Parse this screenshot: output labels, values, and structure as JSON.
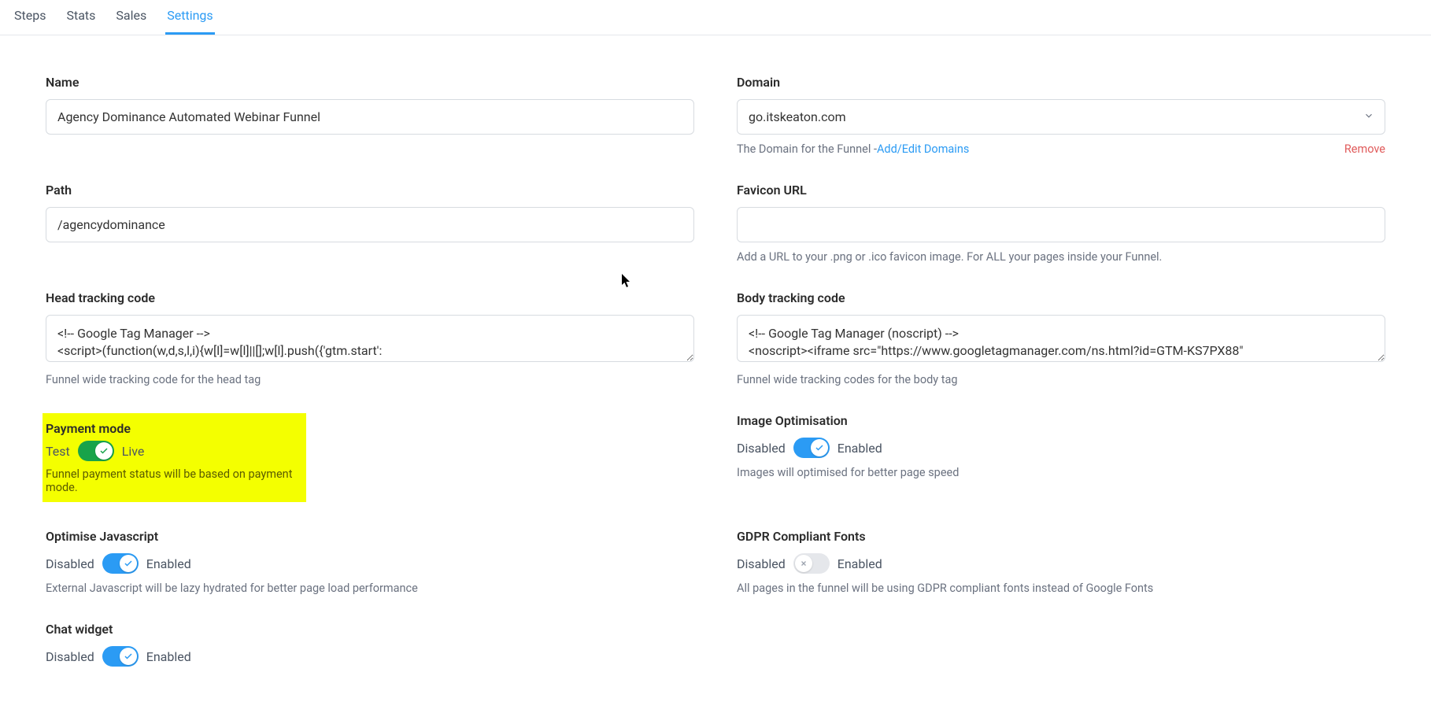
{
  "tabs": {
    "steps": "Steps",
    "stats": "Stats",
    "sales": "Sales",
    "settings": "Settings"
  },
  "left": {
    "name": {
      "label": "Name",
      "value": "Agency Dominance Automated Webinar Funnel"
    },
    "path": {
      "label": "Path",
      "value": "/agencydominance"
    },
    "head_tracking": {
      "label": "Head tracking code",
      "value": "<!-- Google Tag Manager -->\n<script>(function(w,d,s,l,i){w[l]=w[l]||[];w[l].push({'gtm.start':",
      "help": "Funnel wide tracking code for the head tag"
    },
    "payment_mode": {
      "label": "Payment mode",
      "off_label": "Test",
      "on_label": "Live",
      "help": "Funnel payment status will be based on payment mode."
    },
    "optimise_js": {
      "label": "Optimise Javascript",
      "off_label": "Disabled",
      "on_label": "Enabled",
      "help": "External Javascript will be lazy hydrated for better page load performance"
    },
    "chat_widget": {
      "label": "Chat widget",
      "off_label": "Disabled",
      "on_label": "Enabled"
    }
  },
  "right": {
    "domain": {
      "label": "Domain",
      "value": "go.itskeaton.com",
      "help_prefix": "The Domain for the Funnel -",
      "help_link": "Add/Edit Domains",
      "remove": "Remove"
    },
    "favicon": {
      "label": "Favicon URL",
      "value": "",
      "help": "Add a URL to your .png or .ico favicon image. For ALL your pages inside your Funnel."
    },
    "body_tracking": {
      "label": "Body tracking code",
      "value": "<!-- Google Tag Manager (noscript) -->\n<noscript><iframe src=\"https://www.googletagmanager.com/ns.html?id=GTM-KS7PX88\"",
      "help": "Funnel wide tracking codes for the body tag"
    },
    "image_opt": {
      "label": "Image Optimisation",
      "off_label": "Disabled",
      "on_label": "Enabled",
      "help": "Images will optimised for better page speed"
    },
    "gdpr_fonts": {
      "label": "GDPR Compliant Fonts",
      "off_label": "Disabled",
      "on_label": "Enabled",
      "help": "All pages in the funnel will be using GDPR compliant fonts instead of Google Fonts"
    }
  }
}
